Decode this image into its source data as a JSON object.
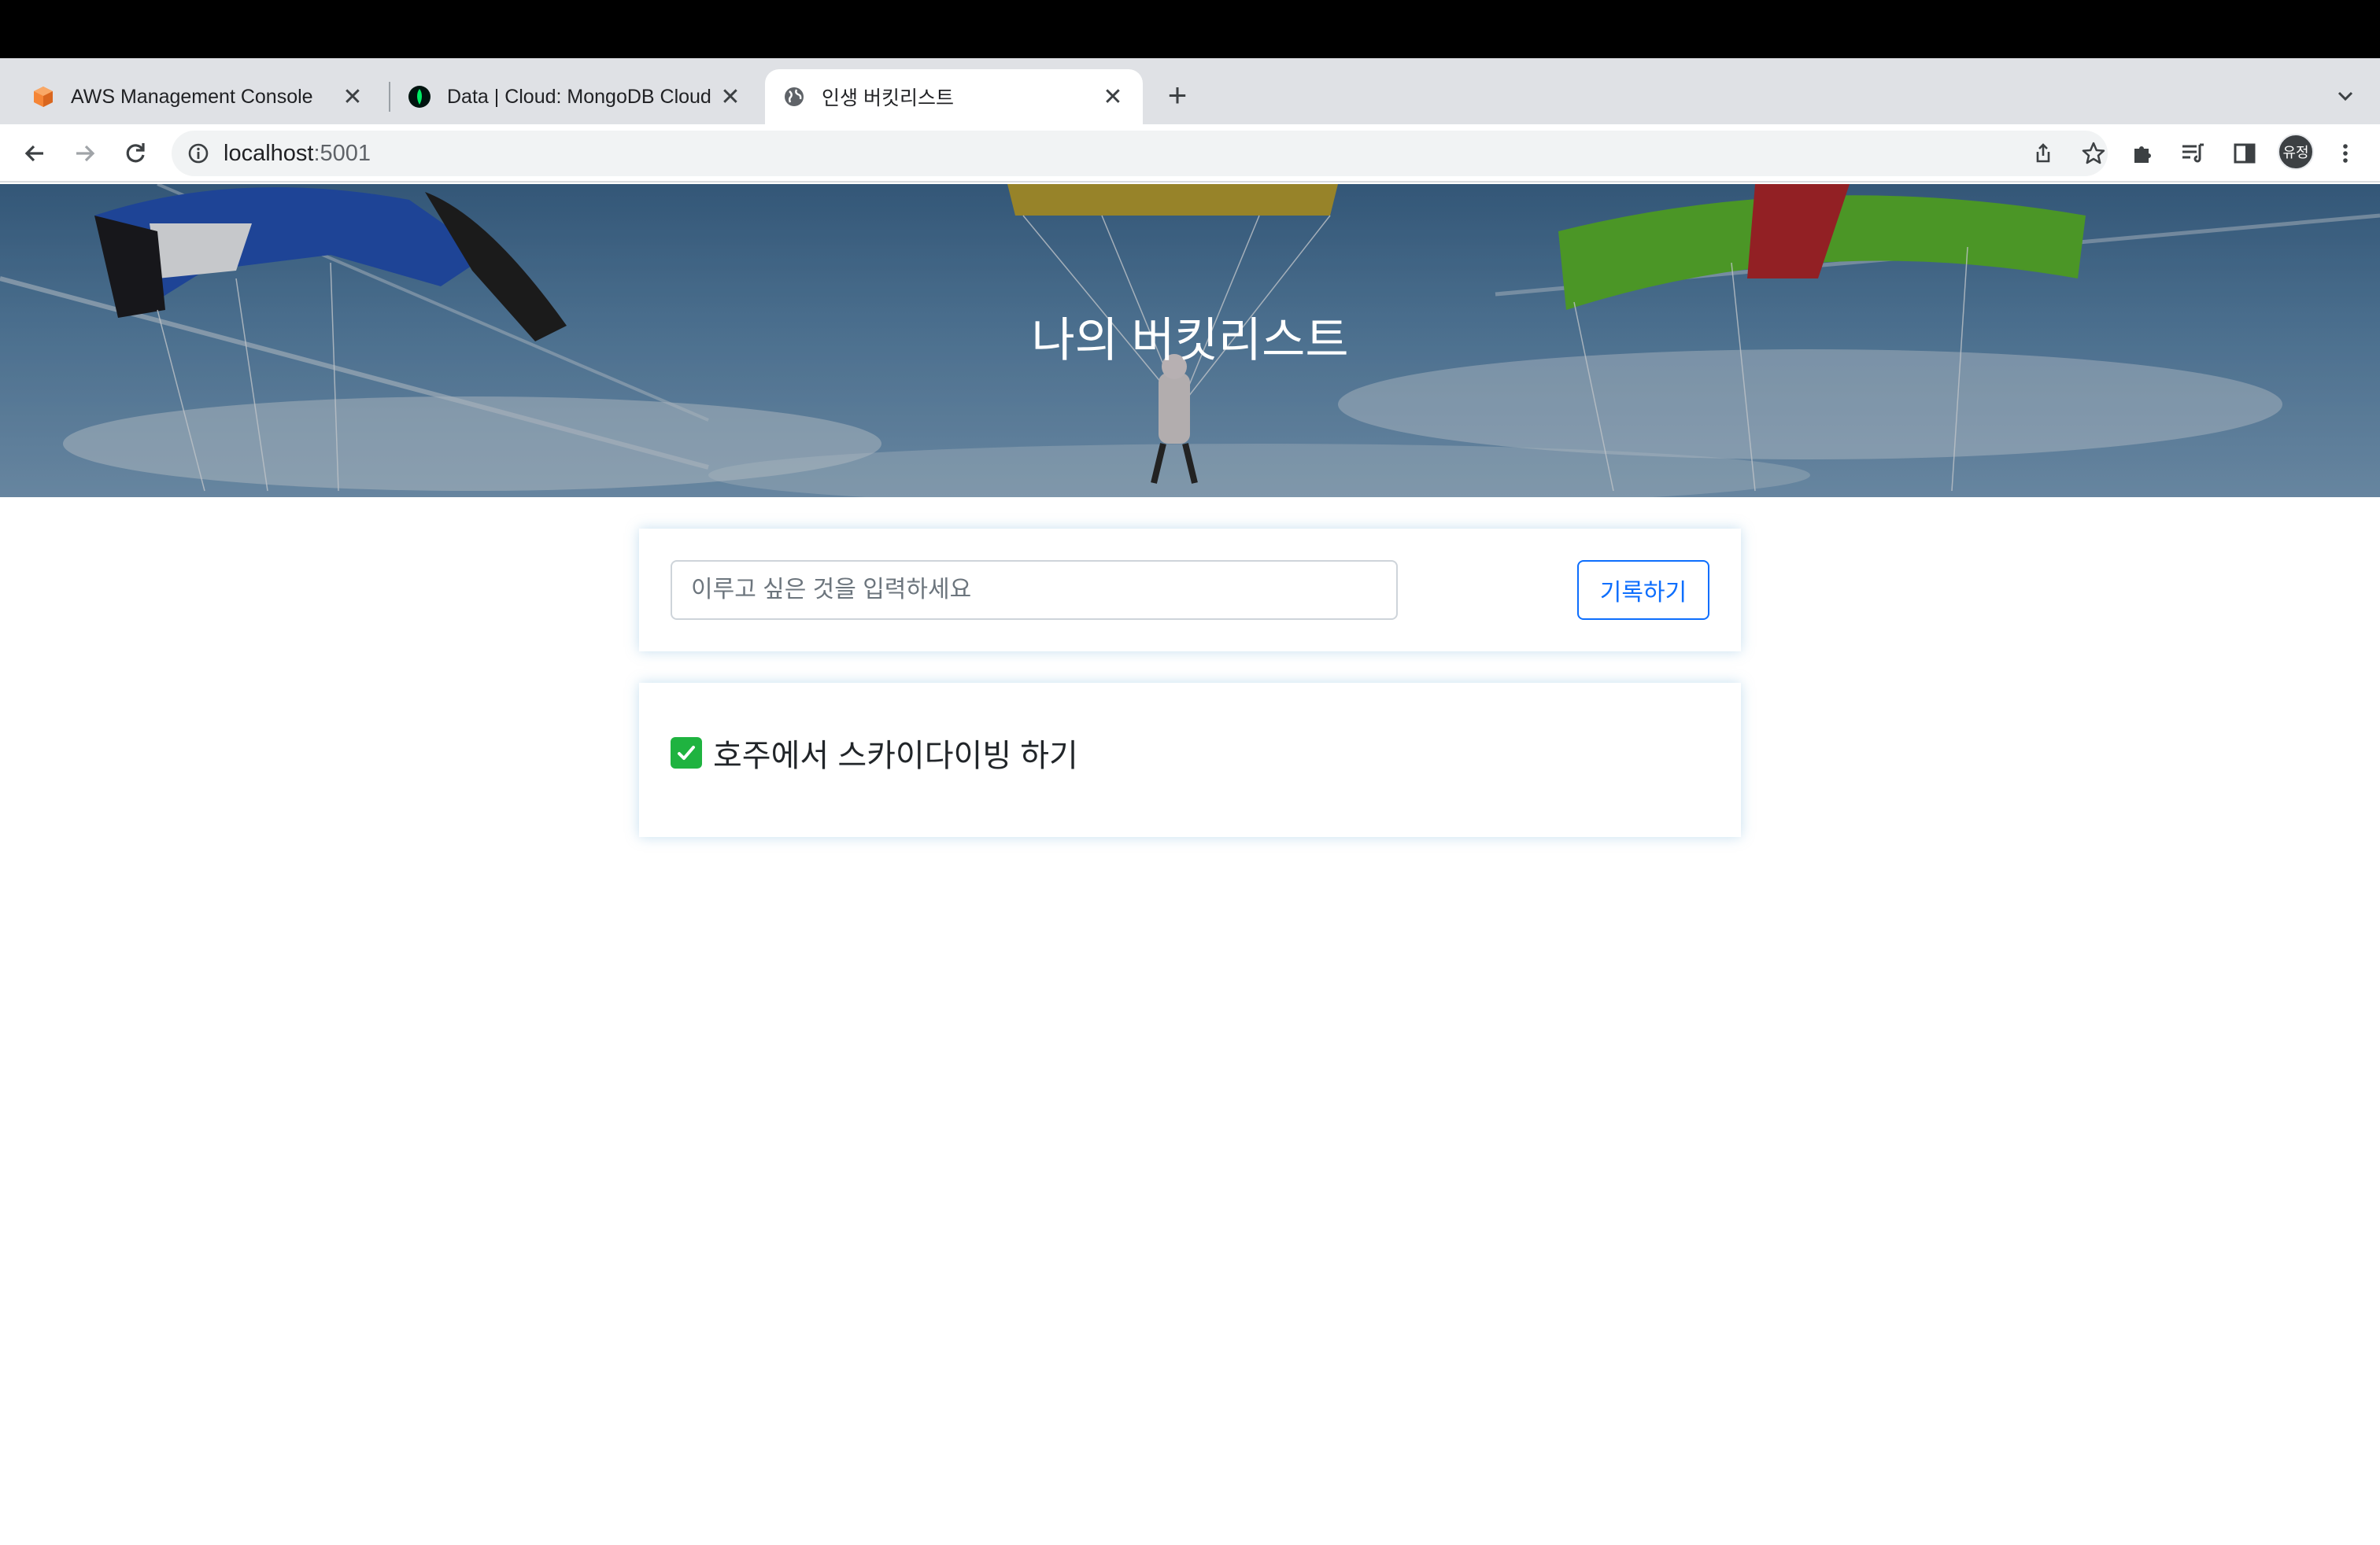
{
  "browser": {
    "tabs": [
      {
        "title": "AWS Management Console",
        "icon": "aws-cube-icon"
      },
      {
        "title": "Data | Cloud: MongoDB Cloud",
        "icon": "mongodb-leaf-icon"
      },
      {
        "title": "인생 버킷리스트",
        "icon": "globe-icon",
        "active": true
      }
    ],
    "new_tab_symbol": "+",
    "close_symbol": "✕",
    "url_host": "localhost",
    "url_port": ":5001",
    "profile_label": "유정"
  },
  "page": {
    "hero_title": "나의 버킷리스트",
    "input_placeholder": "이루고 싶은 것을 입력하세요",
    "save_label": "기록하기",
    "items": [
      {
        "text": "호주에서 스카이다이빙 하기",
        "done": true
      }
    ]
  },
  "colors": {
    "primary": "#0d6efd",
    "done_check": "#1fb340"
  }
}
